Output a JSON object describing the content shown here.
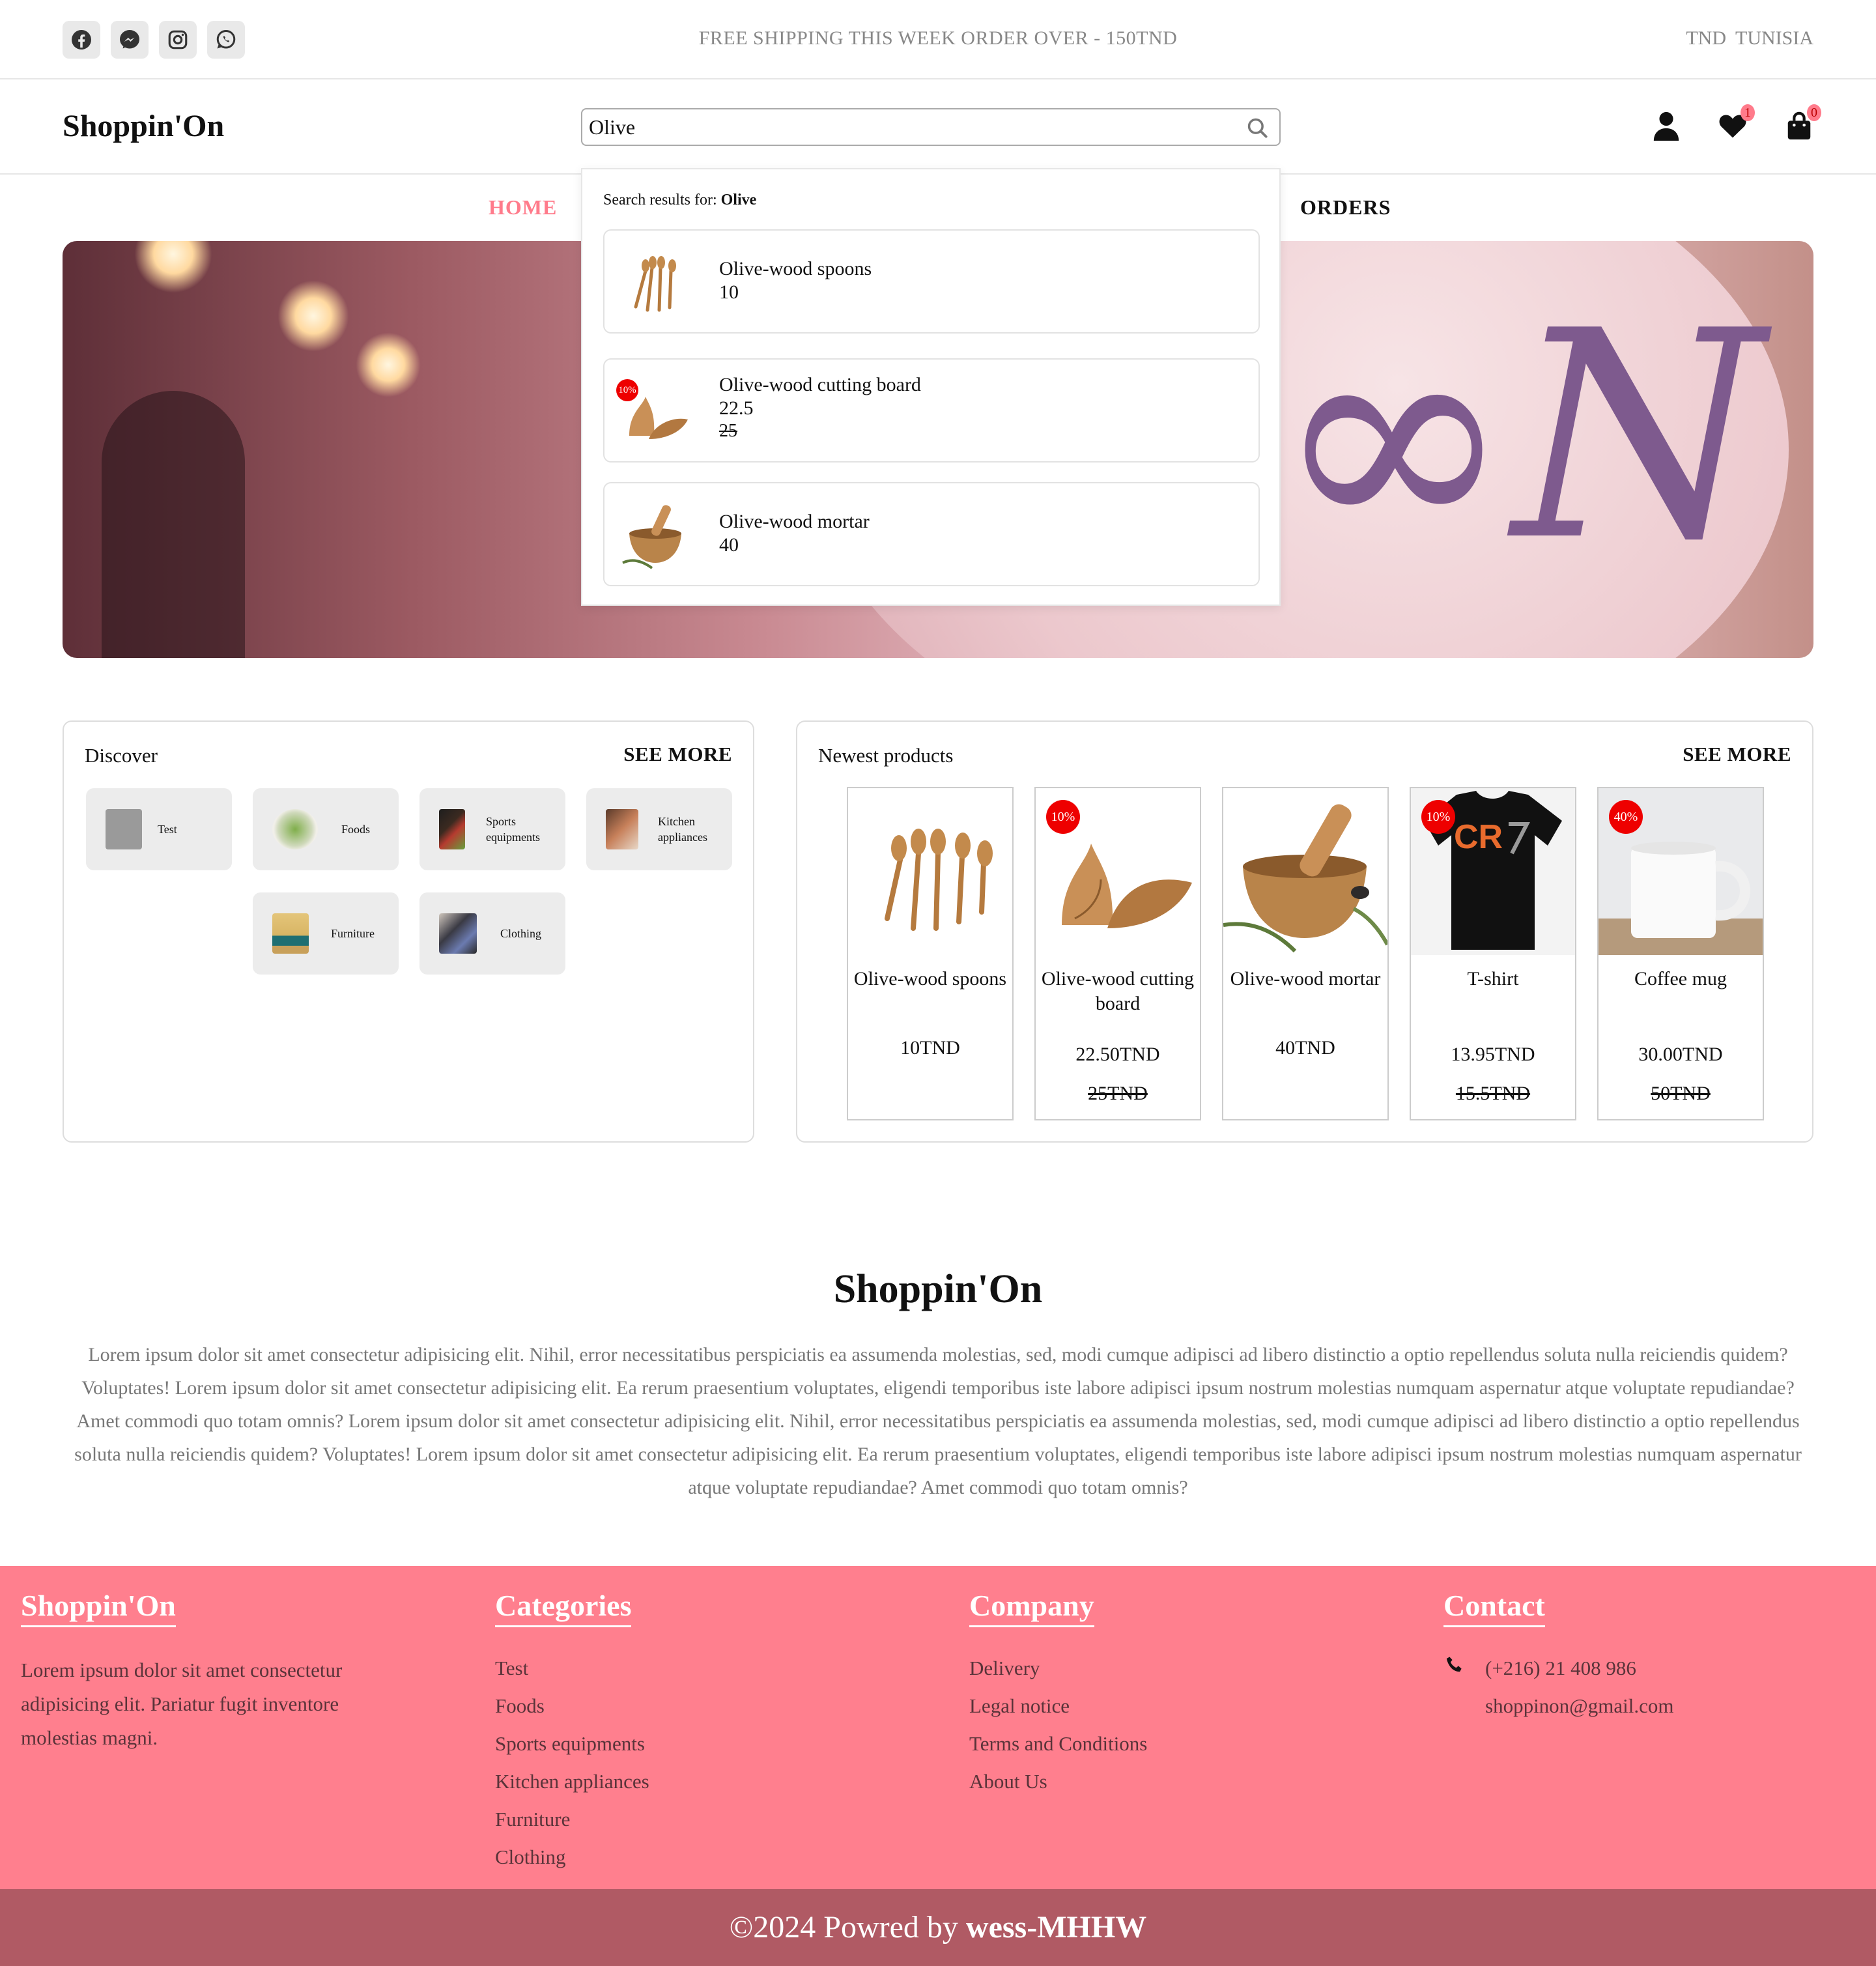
{
  "topbar": {
    "social": [
      {
        "icon": "facebook-icon"
      },
      {
        "icon": "messenger-icon"
      },
      {
        "icon": "instagram-icon"
      },
      {
        "icon": "whatsapp-icon"
      }
    ],
    "promo": "FREE SHIPPING THIS WEEK ORDER OVER - 150TND",
    "currency": "TND",
    "country": "TUNISIA"
  },
  "header": {
    "logo": "Shoppin'On",
    "search": {
      "value": "Olive"
    },
    "wishlist_count": "1",
    "cart_count": "0"
  },
  "nav": {
    "home": "HOME",
    "orders": "ORDERS"
  },
  "search_results": {
    "label": "Search results for:",
    "query": "Olive",
    "items": [
      {
        "name": "Olive-wood spoons",
        "price": "10"
      },
      {
        "name": "Olive-wood cutting board",
        "price": "22.5",
        "old_price": "25",
        "discount": "10%"
      },
      {
        "name": "Olive-wood mortar",
        "price": "40"
      }
    ]
  },
  "discover": {
    "title": "Discover",
    "see_more": "SEE MORE",
    "categories": [
      "Test",
      "Foods",
      "Sports equipments",
      "Kitchen appliances",
      "Furniture",
      "Clothing"
    ]
  },
  "newest": {
    "title": "Newest products",
    "see_more": "SEE MORE",
    "products": [
      {
        "name": "Olive-wood spoons",
        "price": "10TND"
      },
      {
        "name": "Olive-wood cutting board",
        "price": "22.50TND",
        "old_price": "25TND",
        "discount": "10%"
      },
      {
        "name": "Olive-wood mortar",
        "price": "40TND"
      },
      {
        "name": "T-shirt",
        "price": "13.95TND",
        "old_price": "15.5TND",
        "discount": "10%"
      },
      {
        "name": "Coffee mug",
        "price": "30.00TND",
        "old_price": "50TND",
        "discount": "40%"
      }
    ]
  },
  "about": {
    "title": "Shoppin'On",
    "text": "Lorem ipsum dolor sit amet consectetur adipisicing elit. Nihil, error necessitatibus perspiciatis ea assumenda molestias, sed, modi cumque adipisci ad libero distinctio a optio repellendus soluta nulla reiciendis quidem? Voluptates! Lorem ipsum dolor sit amet consectetur adipisicing elit. Ea rerum praesentium voluptates, eligendi temporibus iste labore adipisci ipsum nostrum molestias numquam aspernatur atque voluptate repudiandae? Amet commodi quo totam omnis? Lorem ipsum dolor sit amet consectetur adipisicing elit. Nihil, error necessitatibus perspiciatis ea assumenda molestias, sed, modi cumque adipisci ad libero distinctio a optio repellendus soluta nulla reiciendis quidem? Voluptates! Lorem ipsum dolor sit amet consectetur adipisicing elit. Ea rerum praesentium voluptates, eligendi temporibus iste labore adipisci ipsum nostrum molestias numquam aspernatur atque voluptate repudiandae? Amet commodi quo totam omnis?"
  },
  "footer": {
    "brand": {
      "title": "Shoppin'On",
      "text": "Lorem ipsum dolor sit amet consectetur adipisicing elit. Pariatur fugit inventore molestias magni."
    },
    "categories": {
      "title": "Categories",
      "items": [
        "Test",
        "Foods",
        "Sports equipments",
        "Kitchen appliances",
        "Furniture",
        "Clothing"
      ]
    },
    "company": {
      "title": "Company",
      "items": [
        "Delivery",
        "Legal notice",
        "Terms and Conditions",
        "About Us"
      ]
    },
    "contact": {
      "title": "Contact",
      "phone": "(+216) 21 408 986",
      "email": "shoppinon@gmail.com"
    }
  },
  "copyright": {
    "prefix": "©2024 Powred by",
    "author": "wess-MHHW"
  },
  "colors": {
    "accent": "#ff7f8e",
    "footer_bottom": "#b05a64",
    "discount_badge": "#e00000"
  }
}
